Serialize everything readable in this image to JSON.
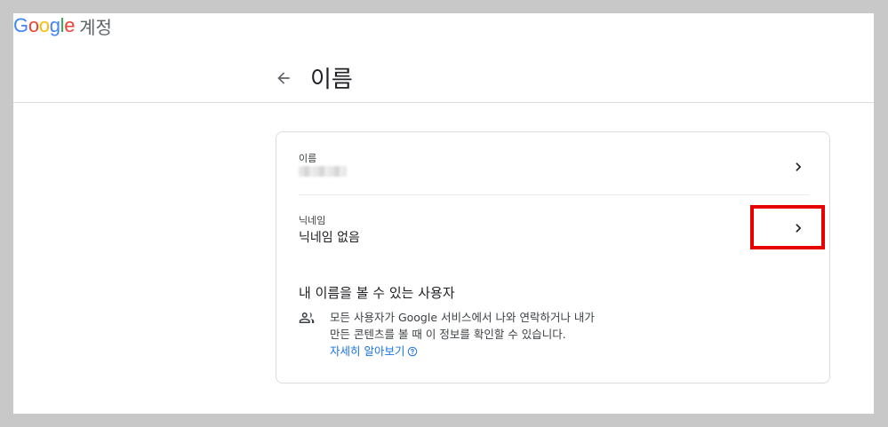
{
  "header": {
    "logo_letters": [
      {
        "ch": "G",
        "color": "#4285F4"
      },
      {
        "ch": "o",
        "color": "#EA4335"
      },
      {
        "ch": "o",
        "color": "#FBBC05"
      },
      {
        "ch": "g",
        "color": "#4285F4"
      },
      {
        "ch": "l",
        "color": "#34A853"
      },
      {
        "ch": "e",
        "color": "#EA4335"
      }
    ],
    "suffix": "계정"
  },
  "page": {
    "back_icon": "arrow-back-icon",
    "title": "이름"
  },
  "card": {
    "name_row": {
      "label": "이름",
      "value_redacted": true,
      "chevron_icon": "chevron-right-icon"
    },
    "nickname_row": {
      "label": "닉네임",
      "value": "닉네임 없음",
      "chevron_icon": "chevron-right-icon",
      "highlighted": true,
      "highlight_color": "#e60000"
    },
    "visibility": {
      "title": "내 이름을 볼 수 있는 사용자",
      "icon": "people-icon",
      "line1": "모든 사용자가 Google 서비스에서 나와 연락하거나 내가",
      "line2": "만든 콘텐츠를 볼 때 이 정보를 확인할 수 있습니다.",
      "link": "자세히 알아보기",
      "help_icon": "help-circle-icon"
    }
  },
  "colors": {
    "link": "#1a73e8",
    "border": "#dadce0",
    "text": "#202124"
  }
}
